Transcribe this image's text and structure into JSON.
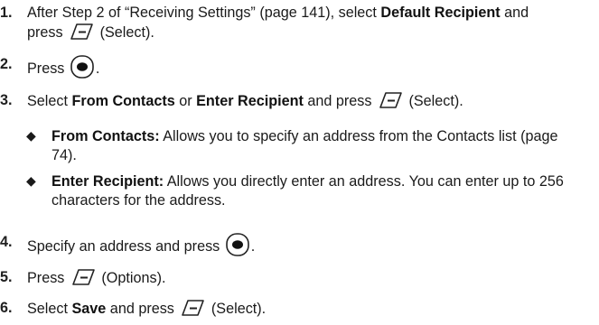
{
  "steps": [
    {
      "num": "1.",
      "a": "After Step 2 of “Receiving Settings” (page 141), select ",
      "b": "Default Recipient",
      "c": " and",
      "d": "press ",
      "e": " (Select)."
    },
    {
      "num": "2.",
      "a": "Press ",
      "b": "."
    },
    {
      "num": "3.",
      "a": "Select ",
      "b": "From Contacts",
      "c": " or ",
      "d": "Enter Recipient",
      "e": " and press ",
      "f": " (Select)."
    },
    {
      "num": "4.",
      "a": "Specify an address and press ",
      "b": "."
    },
    {
      "num": "5.",
      "a": "Press ",
      "b": " (Options)."
    },
    {
      "num": "6.",
      "a": "Select ",
      "b": "Save",
      "c": " and press ",
      "d": " (Select)."
    }
  ],
  "bullets": [
    {
      "glyph": "◆",
      "term": "From Contacts:",
      "line1": " Allows you to specify an address from the Contacts list (page",
      "line2": "74)."
    },
    {
      "glyph": "◆",
      "term": "Enter Recipient:",
      "line1": " Allows you directly enter an address. You can enter up to 256",
      "line2": "characters for the address."
    }
  ],
  "icons": {
    "softkey": "left-softkey-icon",
    "navkey": "menu-ok-key-icon"
  }
}
